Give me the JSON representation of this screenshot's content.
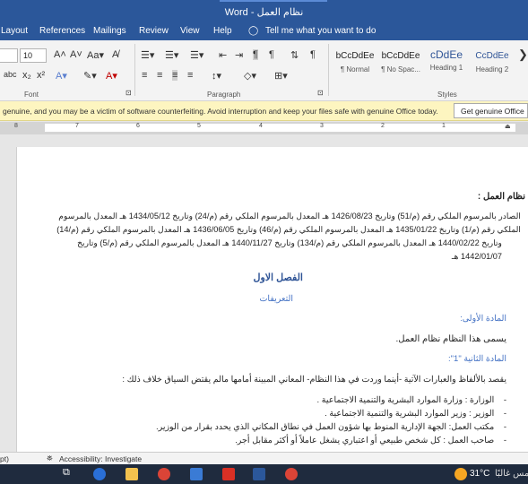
{
  "window": {
    "title": "Word  -  نظام العمل"
  },
  "menu": [
    "Layout",
    "References",
    "Mailings",
    "Review",
    "View",
    "Help"
  ],
  "tell_me": "Tell me what you want to do",
  "ribbon": {
    "font_name": "",
    "font_size": "10",
    "font_group": "Font",
    "paragraph_group": "Paragraph",
    "styles_group": "Styles",
    "styles": [
      {
        "sample": "bCcDdEe",
        "name": "¶ Normal"
      },
      {
        "sample": "bCcDdEe",
        "name": "¶ No Spac..."
      },
      {
        "sample": "cDdEe",
        "name": "Heading 1"
      },
      {
        "sample": "CcDdEe",
        "name": "Heading 2"
      }
    ]
  },
  "warning": {
    "message": "genuine, and you may be a victim of software counterfeiting. Avoid interruption and keep your files safe with genuine Office today.",
    "button": "Get genuine Office"
  },
  "ruler_numbers": [
    "8",
    "7",
    "6",
    "5",
    "4",
    "3",
    "2",
    "1"
  ],
  "document": {
    "title": "نظام العمل :",
    "intro_lines": [
      "الصادر بالمرسوم الملكي رقم (م/51) وتاريخ 1426/08/23 هـ المعدل بالمرسوم الملكي رقم (م/24) وتاريخ 1434/05/12 هـ المعدل بالمرسوم",
      "الملكي رقم (م/1) وتاريخ 1435/01/22 هـ المعدل بالمرسوم الملكي رقم (م/46) وتاريخ 1436/06/05 هـ المعدل بالمرسوم الملكي رقم (م/14)",
      "وتاريخ 1440/02/22 هـ المعدل بالمرسوم الملكي رقم (م/134) وتاريخ 1440/11/27 هـ المعدل بالمرسوم الملكي رقم (م/5) وتاريخ",
      "1442/01/07 هـ"
    ],
    "chapter": "الفصل الاول",
    "chapter_sub": "التعريفات",
    "article1_title": "المادة الأولى:",
    "article1_text": "يسمى هذا النظام نظام العمل.",
    "article2_title": "المادة الثانية \"1\":",
    "article2_text": "يقصد بالألفاظ والعبارات الآتية -أينما وردت في هذا النظام- المعاني المبينة أمامها مالم يقتض السياق خلاف ذلك :",
    "definitions": [
      "الوزارة : وزارة الموارد البشرية والتنمية الاجتماعية .",
      "الوزير : وزير الموارد البشرية والتنمية الاجتماعية .",
      "مكتب العمل: الجهة الإدارية المنوط بها شؤون العمل في نطاق المكاني الذي يحدد بقرار من الوزير.",
      "صاحب العمل : كل شخص طبيعي أو اعتباري يشغل عاملاً أو أكثر مقابل أجر."
    ]
  },
  "status": {
    "left": "pt)",
    "accessibility": "Accessibility: Investigate"
  },
  "taskbar": {
    "temperature": "31°C",
    "weather_text": "شمس غالبًا"
  }
}
